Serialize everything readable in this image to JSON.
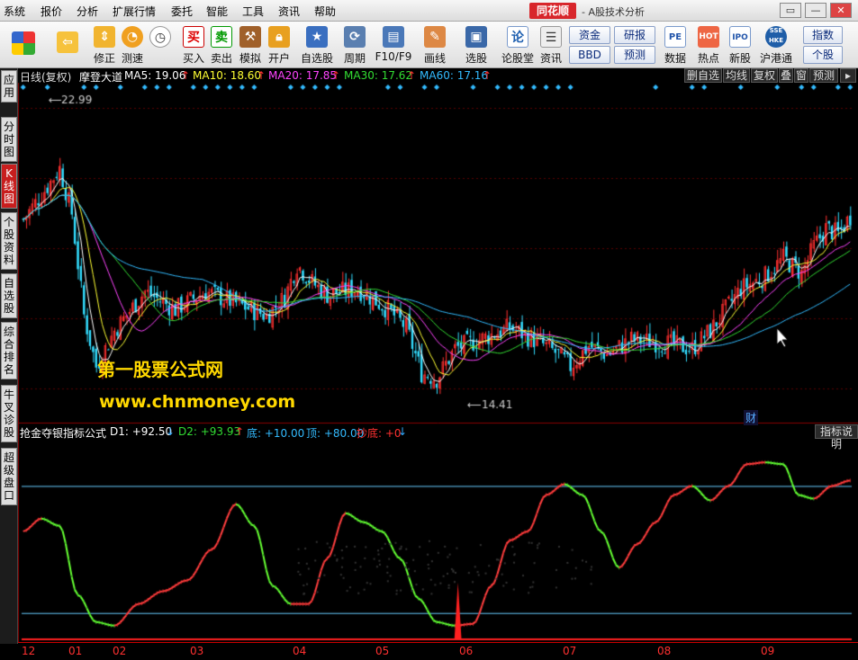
{
  "menu": [
    "系统",
    "报价",
    "分析",
    "扩展行情",
    "委托",
    "智能",
    "工具",
    "资讯",
    "帮助"
  ],
  "brand": {
    "logo": "同花顺",
    "subtitle": "- A股技术分析"
  },
  "window_controls": [
    "▭",
    "—",
    "✕"
  ],
  "toolbar": {
    "buttons": [
      {
        "label": "",
        "icon": "grid-icon"
      },
      {
        "label": "",
        "icon": "back-arrow-icon"
      },
      {
        "label": "修正",
        "icon": "up-down-arrow-icon"
      },
      {
        "label": "测速",
        "icon": "speed-icon"
      },
      {
        "label": "",
        "icon": "clock-icon"
      },
      {
        "label": "买入",
        "icon": "buy-icon",
        "glyph": "买"
      },
      {
        "label": "卖出",
        "icon": "sell-icon",
        "glyph": "卖"
      },
      {
        "label": "模拟",
        "icon": "hammer-icon"
      },
      {
        "label": "开户",
        "icon": "lock-icon"
      },
      {
        "label": "自选股",
        "icon": "star-icon"
      },
      {
        "label": "周期",
        "icon": "period-icon"
      },
      {
        "label": "F10/F9",
        "icon": "f10-icon"
      },
      {
        "label": "画线",
        "icon": "pen-icon"
      },
      {
        "label": "选股",
        "icon": "select-stock-icon"
      },
      {
        "label": "论股堂",
        "icon": "forum-icon",
        "glyph": "论"
      },
      {
        "label": "资讯",
        "icon": "news-icon"
      }
    ],
    "square_buttons": [
      "资金",
      "研报",
      "BBD",
      "预测"
    ],
    "right_buttons": [
      {
        "label": "数据",
        "glyph": "PE"
      },
      {
        "label": "热点",
        "glyph": "HOT"
      },
      {
        "label": "新股",
        "glyph": "IPO"
      },
      {
        "label": "沪港通",
        "glyph": "SSE HKE"
      }
    ],
    "far_right": [
      "指数",
      "个股"
    ]
  },
  "sidebar_tabs": [
    {
      "label": "应用",
      "active": false
    },
    {
      "label": "分时图",
      "active": false
    },
    {
      "label": "K线图",
      "active": true
    },
    {
      "label": "个股资料",
      "active": false
    },
    {
      "label": "自选股",
      "active": false
    },
    {
      "label": "综合排名",
      "active": false
    },
    {
      "label": "牛叉诊股",
      "active": false
    },
    {
      "label": "超级盘口",
      "active": false
    }
  ],
  "main_header": {
    "period": "日线(复权)",
    "stock_name": "摩登大道",
    "ma": [
      {
        "label": "MA5: 19.06",
        "color": "#ffffff"
      },
      {
        "label": "MA10: 18.60",
        "color": "#ffff33"
      },
      {
        "label": "MA20: 17.85",
        "color": "#ff44ff"
      },
      {
        "label": "MA30: 17.62",
        "color": "#33dd33"
      },
      {
        "label": "MA60: 17.16",
        "color": "#33bbff"
      }
    ],
    "right_buttons": [
      "删自选",
      "均线",
      "复权",
      "叠",
      "窗",
      "预测",
      "▸"
    ]
  },
  "price_labels": {
    "high": "22.99",
    "low": "14.41"
  },
  "indicator": {
    "name": "抢金夺银指标公式",
    "d1": "D1: +92.50",
    "d2": "D2: +93.93",
    "bottom": "底: +10.00",
    "top": "顶: +80.00",
    "chaodi": "抄底: +0",
    "help_button": "指标说明"
  },
  "watermark": {
    "line1": "第一股票公式网",
    "line2": "www.chnmoney.com"
  },
  "finance_marker": "财",
  "x_axis": [
    "12",
    "01",
    "02",
    "03",
    "04",
    "05",
    "06",
    "07",
    "08",
    "09"
  ],
  "colors": {
    "up": "#ff3030",
    "down": "#33ddff",
    "background": "#000000",
    "watermark": "#ffd800"
  },
  "chart_data": {
    "type": "candlestick",
    "price_range": [
      13.5,
      24.5
    ],
    "indicator_range": [
      -5,
      105
    ],
    "indicator_lines": [
      10,
      80
    ]
  }
}
